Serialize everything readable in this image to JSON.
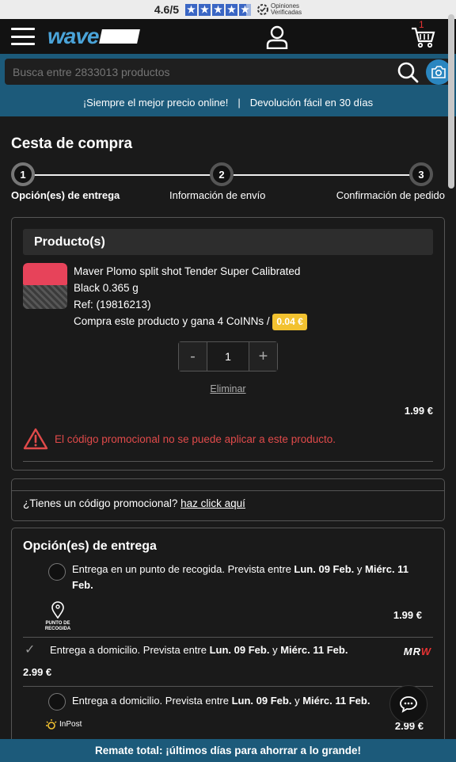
{
  "rating": {
    "score": "4.6/5",
    "brand_line1": "Opiniones",
    "brand_line2": "Verificadas",
    "stars_value": 4.6
  },
  "header": {
    "logo_text": "wave",
    "cart_count": "1"
  },
  "search": {
    "placeholder": "Busca entre 2833013 productos"
  },
  "promo_strip": {
    "left": "¡Siempre el mejor precio online!",
    "separator": "|",
    "right": "Devolución fácil en 30 días"
  },
  "page": {
    "title": "Cesta de compra"
  },
  "steps": [
    {
      "num": "1",
      "label": "Opción(es) de entrega"
    },
    {
      "num": "2",
      "label": "Información de envío"
    },
    {
      "num": "3",
      "label": "Confirmación de pedido"
    }
  ],
  "products": {
    "heading": "Producto(s)",
    "item": {
      "name": "Maver Plomo split shot Tender Super Calibrated",
      "variant": "Black 0.365 g",
      "ref": "Ref: (19816213)",
      "coins_text": "Compra este producto y gana 4 CoINNs /",
      "coins_value": "0.04 €",
      "qty_minus": "-",
      "qty": "1",
      "qty_plus": "+",
      "remove": "Eliminar",
      "price": "1.99 €",
      "error": "El código promocional no se puede aplicar a este producto."
    }
  },
  "coupon": {
    "question": "¿Tienes un código promocional?",
    "link": "haz click aquí"
  },
  "delivery": {
    "heading": "Opción(es) de entrega",
    "options": [
      {
        "text_pre": "Entrega en un punto de recogida. Prevista entre ",
        "from": "Lun. 09 Feb.",
        "mid": " y ",
        "to": "Miérc. 11 Feb.",
        "carrier_label": "PUNTO DE RECOGIDA",
        "price": "1.99 €",
        "selected": false
      },
      {
        "text_pre": "Entrega a domicilio. Prevista entre ",
        "from": "Lun. 09 Feb.",
        "mid": " y ",
        "to": "Miérc. 11 Feb.",
        "carrier_label_a": "MR",
        "carrier_label_b": "W",
        "price": "2.99 €",
        "selected": true
      },
      {
        "text_pre": "Entrega a domicilio. Prevista entre ",
        "from": "Lun. 09 Feb.",
        "mid": " y ",
        "to": "Miérc. 11 Feb.",
        "carrier_label": "InPost",
        "price": "2.99 €",
        "selected": false
      }
    ]
  },
  "bottom_banner": {
    "text": "Remate total: ¡últimos días para ahorrar a lo grande!"
  },
  "colors": {
    "accent": "#1c5a7a",
    "error": "#e04a4a",
    "coin_badge": "#f2c230",
    "logo": "#4aa3d8"
  }
}
